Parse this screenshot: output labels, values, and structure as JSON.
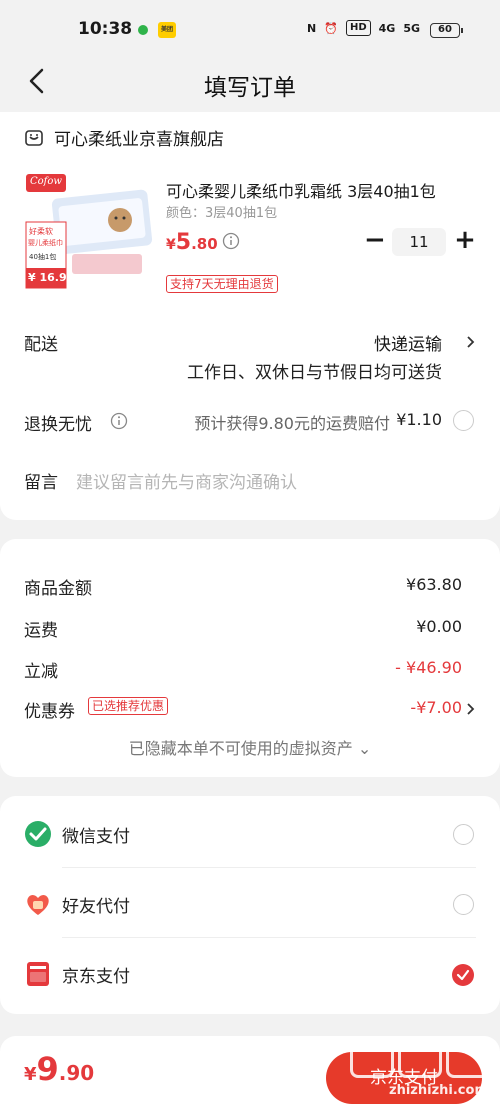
{
  "status_bar": {
    "time": "10:38",
    "app_badge": "美团",
    "battery": "60",
    "network_1": "4G",
    "network_2": "5G"
  },
  "header": {
    "title": "填写订单"
  },
  "shop": {
    "name": "可心柔纸业京喜旗舰店"
  },
  "product": {
    "title": "可心柔婴儿柔纸巾乳霜纸 3层40抽1包",
    "spec": "颜色：3层40抽1包",
    "price_currency": "¥",
    "price_int": "5",
    "price_dec": ".80",
    "quantity": "11",
    "minus_label": "−",
    "plus_label": "+",
    "return_badge": "支持7天无理由退货",
    "image_texts": {
      "brand": "Cofow",
      "line1": "好柔软",
      "line2": "婴儿柔纸巾",
      "line3": "40抽1包",
      "price": "¥ 16.9"
    }
  },
  "delivery": {
    "label": "配送",
    "method": "快递运输",
    "note": "工作日、双休日与节假日均可送货"
  },
  "worry_free": {
    "label": "退换无忧",
    "text": "预计获得9.80元的运费赔付",
    "price": "¥1.10"
  },
  "note": {
    "label": "留言",
    "placeholder": "建议留言前先与商家沟通确认"
  },
  "summary": {
    "rows": [
      {
        "label": "商品金额",
        "value": "¥63.80"
      },
      {
        "label": "运费",
        "value": "¥0.00"
      },
      {
        "label": "立减",
        "value": "- ¥46.90"
      },
      {
        "label": "优惠券",
        "value": "-¥7.00",
        "badge": "已选推荐优惠"
      }
    ],
    "hidden_assets": "已隐藏本单不可使用的虚拟资产 ⌄"
  },
  "payment": {
    "methods": [
      {
        "label": "微信支付",
        "icon": "wechat-pay-icon",
        "selected": false
      },
      {
        "label": "好友代付",
        "icon": "friend-pay-icon",
        "selected": false
      },
      {
        "label": "京东支付",
        "icon": "jd-pay-icon",
        "selected": true
      }
    ]
  },
  "bottom": {
    "total_currency": "¥",
    "total_int": "9",
    "total_dec": ".90",
    "pay_button": "京东支付"
  },
  "watermark": {
    "text": "zhizhizhi.com"
  },
  "colors": {
    "accent": "#e4393c",
    "pay_button": "#e63a2a",
    "wechat_green": "#2aae67",
    "background": "#f2f2f2"
  }
}
